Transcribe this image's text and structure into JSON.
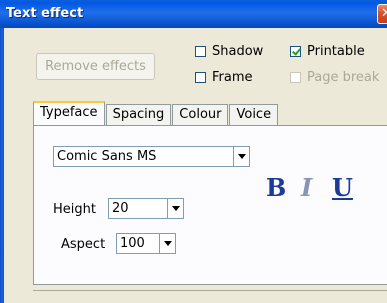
{
  "window": {
    "title": "Text effect",
    "close_glyph": "✕"
  },
  "remove_effects_label": "Remove effects",
  "options": {
    "shadow": {
      "label": "Shadow",
      "checked": false,
      "enabled": true
    },
    "printable": {
      "label": "Printable",
      "checked": true,
      "enabled": true
    },
    "frame": {
      "label": "Frame",
      "checked": false,
      "enabled": true
    },
    "page_break": {
      "label": "Page break",
      "checked": false,
      "enabled": false
    }
  },
  "tabs": [
    {
      "label": "Typeface",
      "active": true
    },
    {
      "label": "Spacing",
      "active": false
    },
    {
      "label": "Colour",
      "active": false
    },
    {
      "label": "Voice",
      "active": false
    }
  ],
  "typeface": {
    "font_value": "Comic Sans MS",
    "height_label": "Height",
    "height_value": "20",
    "aspect_label": "Aspect",
    "aspect_value": "100",
    "bold_glyph": "B",
    "italic_glyph": "I",
    "underline_glyph": "U"
  }
}
